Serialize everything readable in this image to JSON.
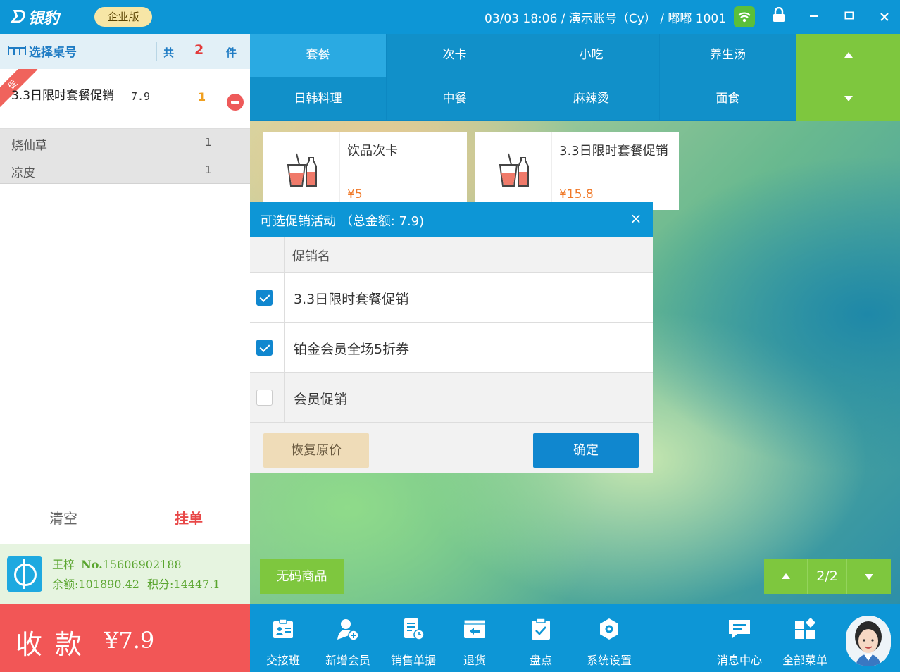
{
  "titlebar": {
    "logo_text": "银豹",
    "edition_label": "企业版",
    "status_text": "03/03 18:06 / 演示账号（Cy） / 嘟嘟 1001"
  },
  "order_panel": {
    "select_table_label": "选择桌号",
    "count_prefix": "共",
    "count_value": "2",
    "count_suffix": "件",
    "main_item": {
      "promo_badge": "促",
      "name": "3.3日限时套餐促销",
      "price": "7.9",
      "qty": "1"
    },
    "sub_items": [
      {
        "name": "烧仙草",
        "qty": "1"
      },
      {
        "name": "凉皮",
        "qty": "1"
      }
    ],
    "clear_label": "清空",
    "hang_label": "挂单"
  },
  "member": {
    "name": "王梓",
    "number_label": "No.",
    "number": "15606902188",
    "balance_label": "余额:",
    "balance": "101890.42",
    "points_label": "积分:",
    "points": "14447.1"
  },
  "checkout": {
    "label": "收款",
    "amount": "¥7.9"
  },
  "categories": [
    {
      "label": "套餐",
      "active": true
    },
    {
      "label": "次卡"
    },
    {
      "label": "小吃"
    },
    {
      "label": "养生汤"
    },
    {
      "label": "日韩料理"
    },
    {
      "label": "中餐"
    },
    {
      "label": "麻辣烫"
    },
    {
      "label": "面食"
    }
  ],
  "products": [
    {
      "name": "饮品次卡",
      "price": "¥5"
    },
    {
      "name": "3.3日限时套餐促销",
      "price": "¥15.8"
    }
  ],
  "no_code_label": "无码商品",
  "pager": {
    "indicator": "2/2"
  },
  "modal": {
    "title": "可选促销活动 （总金额: 7.9)",
    "close_symbol": "×",
    "column_header": "促销名",
    "rows": [
      {
        "name": "3.3日限时套餐促销",
        "checked": true
      },
      {
        "name": "铂金会员全场5折券",
        "checked": true
      },
      {
        "name": "会员促销",
        "checked": false
      }
    ],
    "restore_label": "恢复原价",
    "confirm_label": "确定"
  },
  "toolbar": {
    "items": [
      {
        "label": "交接班",
        "icon": "shift-handover-icon"
      },
      {
        "label": "新增会员",
        "icon": "add-member-icon"
      },
      {
        "label": "销售单据",
        "icon": "sales-receipt-icon"
      },
      {
        "label": "退货",
        "icon": "return-icon"
      },
      {
        "label": "盘点",
        "icon": "inventory-check-icon"
      },
      {
        "label": "系统设置",
        "icon": "settings-icon"
      },
      {
        "label": "消息中心",
        "icon": "message-icon"
      },
      {
        "label": "全部菜单",
        "icon": "all-menu-icon"
      }
    ]
  },
  "colors": {
    "primary": "#0d96d6",
    "accent_green": "#7ec73e",
    "checkout_red": "#f25656",
    "price_orange": "#f07a2a"
  }
}
